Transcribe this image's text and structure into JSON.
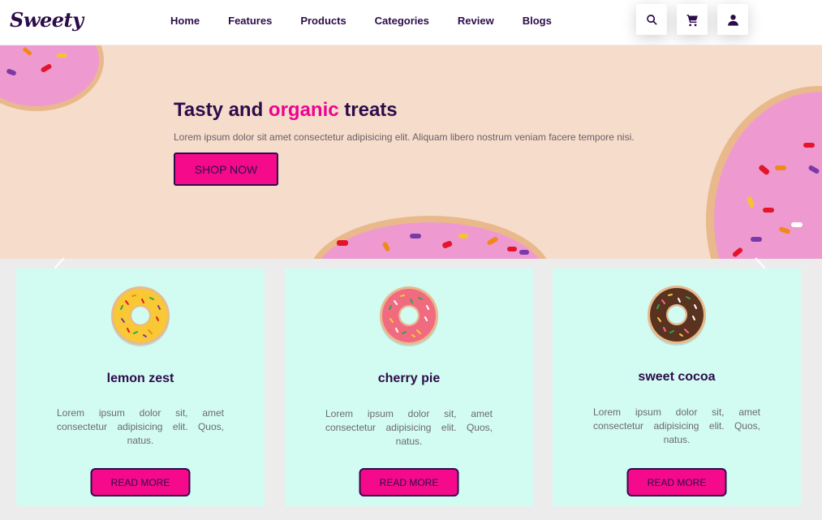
{
  "header": {
    "logo": "Sweety",
    "nav": [
      "Home",
      "Features",
      "Products",
      "Categories",
      "Review",
      "Blogs"
    ],
    "icons": [
      "search-icon",
      "cart-icon",
      "user-icon"
    ]
  },
  "hero": {
    "title_before": "Tasty and ",
    "title_accent": "organic",
    "title_after": " treats",
    "description": "Lorem ipsum dolor sit amet consectetur adipisicing elit. Aliquam libero nostrum veniam facere tempore nisi.",
    "button": "SHOP NOW"
  },
  "cards": [
    {
      "title": "lemon zest",
      "text": "Lorem ipsum dolor sit, amet consectetur adipisicing elit. Quos, natus.",
      "button": "READ MORE"
    },
    {
      "title": "cherry pie",
      "text": "Lorem ipsum dolor sit, amet consectetur adipisicing elit. Quos, natus.",
      "button": "READ MORE"
    },
    {
      "title": "sweet cocoa",
      "text": "Lorem ipsum dolor sit, amet consectetur adipisicing elit. Quos, natus.",
      "button": "READ MORE"
    }
  ],
  "colors": {
    "brand_dark": "#2d0c4a",
    "accent": "#ee0290",
    "hero_bg": "#f5dccb",
    "card_bg": "#d2fbf2"
  }
}
